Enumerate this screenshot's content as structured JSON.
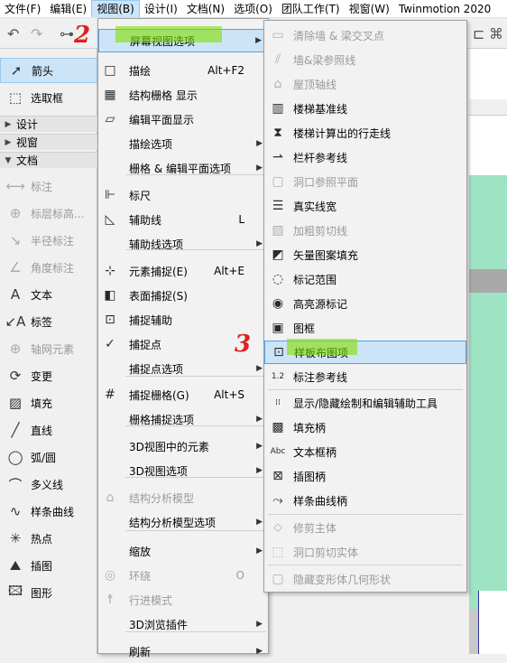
{
  "menubar": {
    "items": [
      "文件(F)",
      "编辑(E)",
      "视图(B)",
      "设计(I)",
      "文档(N)",
      "选项(O)",
      "团队工作(T)",
      "视窗(W)",
      "Twinmotion 2020"
    ]
  },
  "palette": {
    "arrow": "箭头",
    "marquee": "选取框",
    "sections": [
      "设计",
      "视窗",
      "文档"
    ],
    "tools": [
      "标注",
      "标层标高...",
      "半径标注",
      "角度标注",
      "文本",
      "标签",
      "轴网元素",
      "变更",
      "填充",
      "直线",
      "弧/圆",
      "多义线",
      "样条曲线",
      "热点",
      "插图",
      "图形"
    ]
  },
  "view_menu": {
    "items": [
      {
        "label": "屏幕视图选项",
        "shortcut": "",
        "submenu": true,
        "icon": ""
      },
      {
        "label": "描绘",
        "shortcut": "Alt+F2",
        "submenu": false,
        "icon": "□"
      },
      {
        "label": "结构栅格 显示",
        "shortcut": "",
        "submenu": false,
        "icon": "▦"
      },
      {
        "label": "编辑平面显示",
        "shortcut": "",
        "submenu": false,
        "icon": "▱"
      },
      {
        "label": "描绘选项",
        "shortcut": "",
        "submenu": true,
        "icon": ""
      },
      {
        "label": "栅格 & 编辑平面选项",
        "shortcut": "",
        "submenu": true,
        "icon": ""
      },
      {
        "label": "标尺",
        "shortcut": "",
        "submenu": false,
        "icon": "⊩"
      },
      {
        "label": "辅助线",
        "shortcut": "L",
        "submenu": false,
        "icon": "◺"
      },
      {
        "label": "辅助线选项",
        "shortcut": "",
        "submenu": true,
        "icon": ""
      },
      {
        "label": "元素捕捉(E)",
        "shortcut": "Alt+E",
        "submenu": false,
        "icon": "⊹"
      },
      {
        "label": "表面捕捉(S)",
        "shortcut": "",
        "submenu": false,
        "icon": "◧"
      },
      {
        "label": "捕捉辅助",
        "shortcut": "",
        "submenu": false,
        "icon": "⊡"
      },
      {
        "label": "捕捉点",
        "shortcut": "",
        "submenu": false,
        "icon": "✓"
      },
      {
        "label": "捕捉点选项",
        "shortcut": "",
        "submenu": true,
        "icon": ""
      },
      {
        "label": "捕捉栅格(G)",
        "shortcut": "Alt+S",
        "submenu": false,
        "icon": "#"
      },
      {
        "label": "栅格捕捉选项",
        "shortcut": "",
        "submenu": true,
        "icon": ""
      },
      {
        "label": "3D视图中的元素",
        "shortcut": "",
        "submenu": true,
        "icon": ""
      },
      {
        "label": "3D视图选项",
        "shortcut": "",
        "submenu": true,
        "icon": ""
      },
      {
        "label": "结构分析模型",
        "shortcut": "",
        "submenu": false,
        "icon": "⌂"
      },
      {
        "label": "结构分析模型选项",
        "shortcut": "",
        "submenu": true,
        "icon": ""
      },
      {
        "label": "缩放",
        "shortcut": "",
        "submenu": true,
        "icon": ""
      },
      {
        "label": "环绕",
        "shortcut": "O",
        "submenu": false,
        "icon": "◎"
      },
      {
        "label": "行进模式",
        "shortcut": "",
        "submenu": false,
        "icon": "☨"
      },
      {
        "label": "3D浏览插件",
        "shortcut": "",
        "submenu": true,
        "icon": ""
      },
      {
        "label": "刷新",
        "shortcut": "",
        "submenu": true,
        "icon": ""
      }
    ]
  },
  "screen_submenu": {
    "items": [
      {
        "label": "清除墙 & 梁交叉点",
        "icon": "▭"
      },
      {
        "label": "墙&梁参照线",
        "icon": "⫽"
      },
      {
        "label": "屋顶轴线",
        "icon": "⌂"
      },
      {
        "label": "楼梯基准线",
        "icon": "▥"
      },
      {
        "label": "楼梯计算出的行走线",
        "icon": "⧗"
      },
      {
        "label": "栏杆参考线",
        "icon": "⇀"
      },
      {
        "label": "洞口参照平面",
        "icon": "▢"
      },
      {
        "label": "真实线宽",
        "icon": "☰"
      },
      {
        "label": "加粗剪切线",
        "icon": "▧"
      },
      {
        "label": "矢量图案填充",
        "icon": "◩"
      },
      {
        "label": "标记范围",
        "icon": "◌"
      },
      {
        "label": "高亮源标记",
        "icon": "◉"
      },
      {
        "label": "图框",
        "icon": "▣"
      },
      {
        "label": "样板布图项",
        "icon": "⊡"
      },
      {
        "label": "标注参考线",
        "icon": "1.2"
      },
      {
        "label": "显示/隐藏绘制和编辑辅助工具",
        "icon": "⁞⁞"
      },
      {
        "label": "填充柄",
        "icon": "▩"
      },
      {
        "label": "文本框柄",
        "icon": "Abc"
      },
      {
        "label": "插图柄",
        "icon": "⊠"
      },
      {
        "label": "样条曲线柄",
        "icon": "⤳"
      },
      {
        "label": "修剪主体",
        "icon": "⬦"
      },
      {
        "label": "洞口剪切实体",
        "icon": "⬚"
      },
      {
        "label": "隐藏变形体几何形状",
        "icon": "▢"
      }
    ]
  },
  "annotations": [
    "2",
    "3"
  ],
  "colors": {
    "menu_highlight": "#cce4f7",
    "annotation": "#e02020",
    "marker": "#7ee000",
    "canvas_green": "#9de3c4"
  }
}
